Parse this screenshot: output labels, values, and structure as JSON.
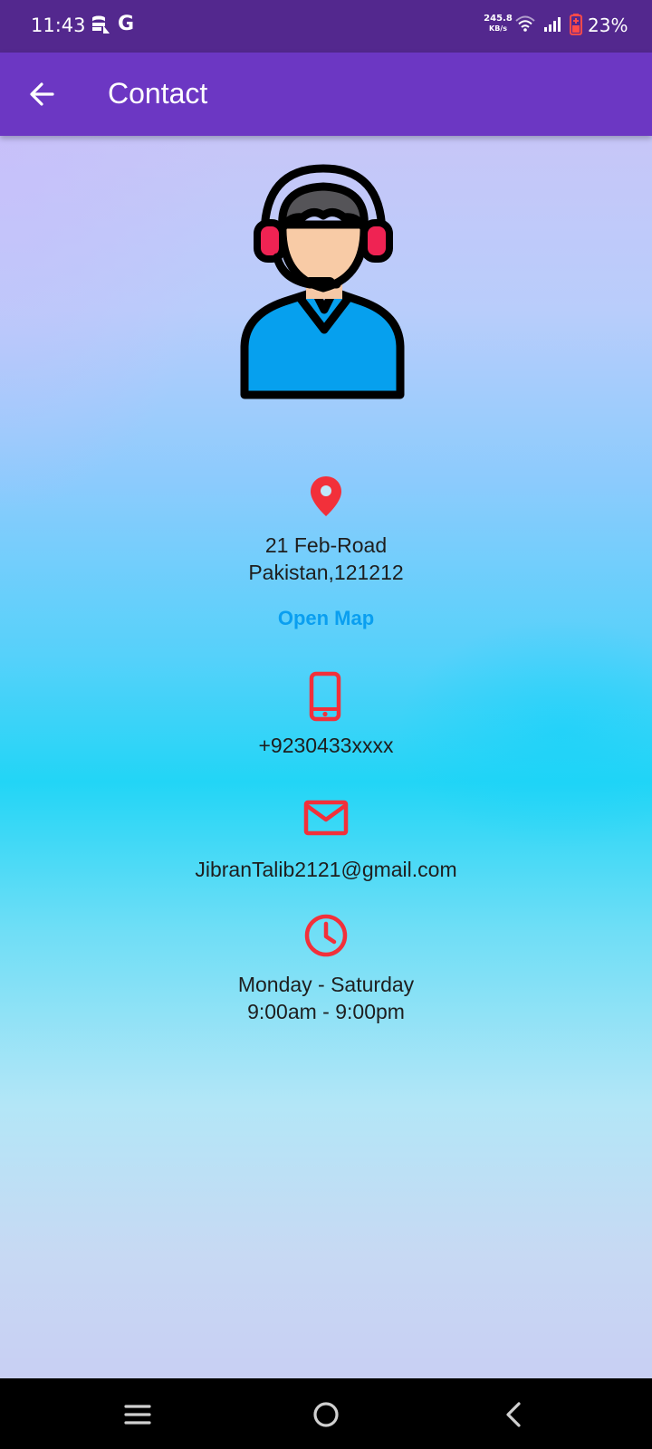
{
  "status_bar": {
    "time": "11:43",
    "carrier_letter": "G",
    "net_speed_value": "245.8",
    "net_speed_unit": "KB/s",
    "battery_percent": "23%",
    "icons": [
      "data-saver-icon",
      "wifi-icon",
      "signal-icon",
      "battery-icon"
    ]
  },
  "app_bar": {
    "back_icon": "arrow-back-icon",
    "title": "Contact"
  },
  "contact": {
    "avatar_icon": "support-agent-icon",
    "address": {
      "icon": "location-pin-icon",
      "line1": "21 Feb-Road",
      "line2": "Pakistan,121212",
      "link_label": "Open Map"
    },
    "phone": {
      "icon": "smartphone-icon",
      "number": "+9230433xxxx"
    },
    "email": {
      "icon": "mail-icon",
      "address": "JibranTalib2121@gmail.com"
    },
    "hours": {
      "icon": "clock-icon",
      "days": "Monday - Saturday",
      "time": "9:00am - 9:00pm"
    }
  },
  "nav_bar": {
    "icons": [
      "menu-icon",
      "home-icon",
      "back-icon"
    ]
  },
  "colors": {
    "status_bar": "#53288e",
    "app_bar": "#6c37c3",
    "icon_red": "#f2303a",
    "link_blue": "#0a9ff0"
  }
}
